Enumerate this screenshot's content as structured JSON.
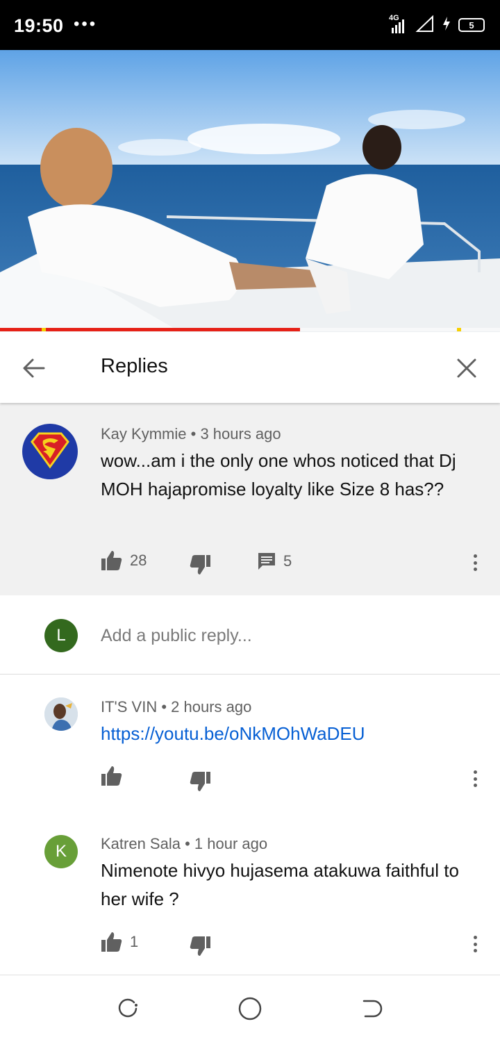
{
  "status_bar": {
    "time": "19:50",
    "dots": "•••",
    "network": "4G",
    "battery": "5"
  },
  "video": {
    "progress": 0.6
  },
  "header": {
    "title": "Replies"
  },
  "parent_comment": {
    "author": "Kay Kymmie",
    "time": "3 hours ago",
    "text": "wow...am i the only one whos noticed that Dj MOH hajapromise loyalty like Size 8 has??",
    "likes": "28",
    "replies": "5"
  },
  "add_reply": {
    "avatar_letter": "L",
    "placeholder": "Add a public reply..."
  },
  "replies": [
    {
      "author": "IT'S VIN",
      "time": "2 hours ago",
      "text": "https://youtu.be/oNkMOhWaDEU",
      "likes": ""
    },
    {
      "author": "Katren Sala",
      "time": "1 hour ago",
      "avatar_letter": "K",
      "text": "Nimenote hivyo hujasema atakuwa faithful to her wife ?",
      "likes": "1"
    }
  ],
  "colors": {
    "accent_red": "#e62117",
    "link_blue": "#065fd4",
    "avatar_green_dark": "#33691e",
    "avatar_green": "#689f38"
  }
}
